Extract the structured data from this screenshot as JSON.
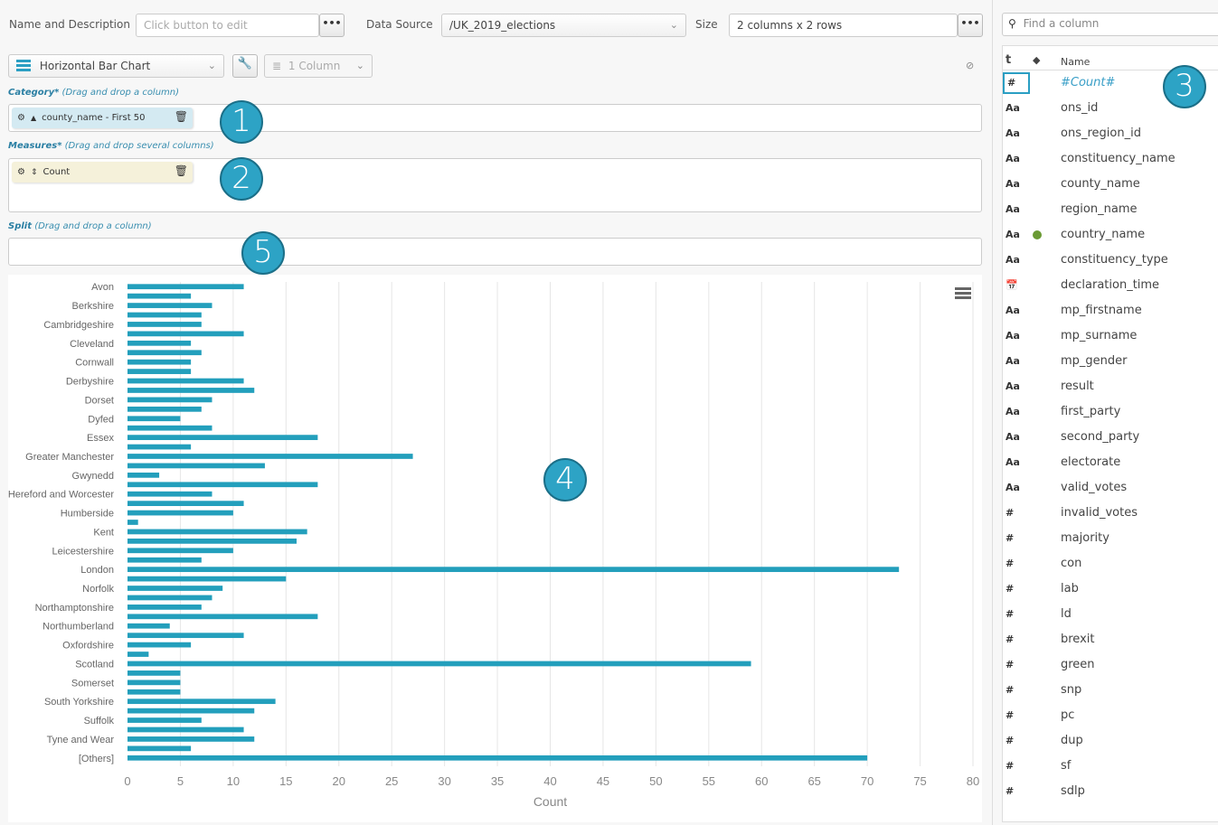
{
  "toolbar": {
    "name_label": "Name and Description",
    "name_placeholder": "Click button to edit",
    "more_label": "•••",
    "datasource_label": "Data Source",
    "datasource_value": "/UK_2019_elections",
    "size_label": "Size",
    "size_value": "2 columns x 2 rows",
    "chart_type": "Horizontal Bar Chart",
    "columns_value": "1 Column",
    "wrench_icon": "wrench-icon",
    "hidden_icon": "eye-slash-icon"
  },
  "category": {
    "title": "Category*",
    "hint": "(Drag and drop a column)",
    "pill": "county_name - First 50",
    "sort_icon": "▲"
  },
  "measures": {
    "title": "Measures*",
    "hint": "(Drag and drop several columns)",
    "pill": "Count",
    "sort_icon": "⇕"
  },
  "split": {
    "title": "Split",
    "hint": "(Drag and drop a column)"
  },
  "badges": [
    "1",
    "2",
    "3",
    "4",
    "5"
  ],
  "sidebar": {
    "search_placeholder": "Find a column",
    "header_type": "t",
    "header_name": "Name",
    "columns": [
      {
        "type": "#",
        "name": "#Count#",
        "selected": true
      },
      {
        "type": "Aa",
        "name": "ons_id"
      },
      {
        "type": "Aa",
        "name": "ons_region_id"
      },
      {
        "type": "Aa",
        "name": "constituency_name"
      },
      {
        "type": "Aa",
        "name": "county_name"
      },
      {
        "type": "Aa",
        "name": "region_name"
      },
      {
        "type": "Aa",
        "name": "country_name",
        "geo": true
      },
      {
        "type": "Aa",
        "name": "constituency_type"
      },
      {
        "type": "📅",
        "name": "declaration_time"
      },
      {
        "type": "Aa",
        "name": "mp_firstname"
      },
      {
        "type": "Aa",
        "name": "mp_surname"
      },
      {
        "type": "Aa",
        "name": "mp_gender"
      },
      {
        "type": "Aa",
        "name": "result"
      },
      {
        "type": "Aa",
        "name": "first_party"
      },
      {
        "type": "Aa",
        "name": "second_party"
      },
      {
        "type": "Aa",
        "name": "electorate"
      },
      {
        "type": "Aa",
        "name": "valid_votes"
      },
      {
        "type": "#",
        "name": "invalid_votes"
      },
      {
        "type": "#",
        "name": "majority"
      },
      {
        "type": "#",
        "name": "con"
      },
      {
        "type": "#",
        "name": "lab"
      },
      {
        "type": "#",
        "name": "ld"
      },
      {
        "type": "#",
        "name": "brexit"
      },
      {
        "type": "#",
        "name": "green"
      },
      {
        "type": "#",
        "name": "snp"
      },
      {
        "type": "#",
        "name": "pc"
      },
      {
        "type": "#",
        "name": "dup"
      },
      {
        "type": "#",
        "name": "sf"
      },
      {
        "type": "#",
        "name": "sdlp"
      }
    ]
  },
  "colors": {
    "bar": "#239fbc",
    "accent": "#2a9ec3",
    "grid": "#e6e6e6"
  },
  "chart_data": {
    "type": "bar",
    "orientation": "horizontal",
    "title": "",
    "xlabel": "Count",
    "ylabel": "",
    "xlim": [
      0,
      80
    ],
    "xticks": [
      0,
      5,
      10,
      15,
      20,
      25,
      30,
      35,
      40,
      45,
      50,
      55,
      60,
      65,
      70,
      75,
      80
    ],
    "grid": true,
    "categories": [
      "Avon",
      "",
      "Berkshire",
      "",
      "Cambridgeshire",
      "",
      "Cleveland",
      "",
      "Cornwall",
      "",
      "Derbyshire",
      "",
      "Dorset",
      "",
      "Dyfed",
      "",
      "Essex",
      "",
      "Greater Manchester",
      "",
      "Gwynedd",
      "",
      "Hereford and Worcester",
      "",
      "Humberside",
      "",
      "Kent",
      "",
      "Leicestershire",
      "",
      "London",
      "",
      "Norfolk",
      "",
      "Northamptonshire",
      "",
      "Northumberland",
      "",
      "Oxfordshire",
      "",
      "Scotland",
      "",
      "Somerset",
      "",
      "South Yorkshire",
      "",
      "Suffolk",
      "",
      "Tyne and Wear",
      "",
      "[Others]"
    ],
    "series": [
      {
        "name": "Count",
        "values": [
          11,
          6,
          8,
          7,
          7,
          11,
          6,
          7,
          6,
          6,
          11,
          12,
          8,
          7,
          5,
          8,
          18,
          6,
          27,
          13,
          3,
          18,
          8,
          11,
          10,
          1,
          17,
          16,
          10,
          7,
          73,
          15,
          9,
          8,
          7,
          18,
          4,
          11,
          6,
          2,
          59,
          5,
          5,
          5,
          14,
          12,
          7,
          11,
          12,
          6,
          70
        ]
      }
    ]
  }
}
